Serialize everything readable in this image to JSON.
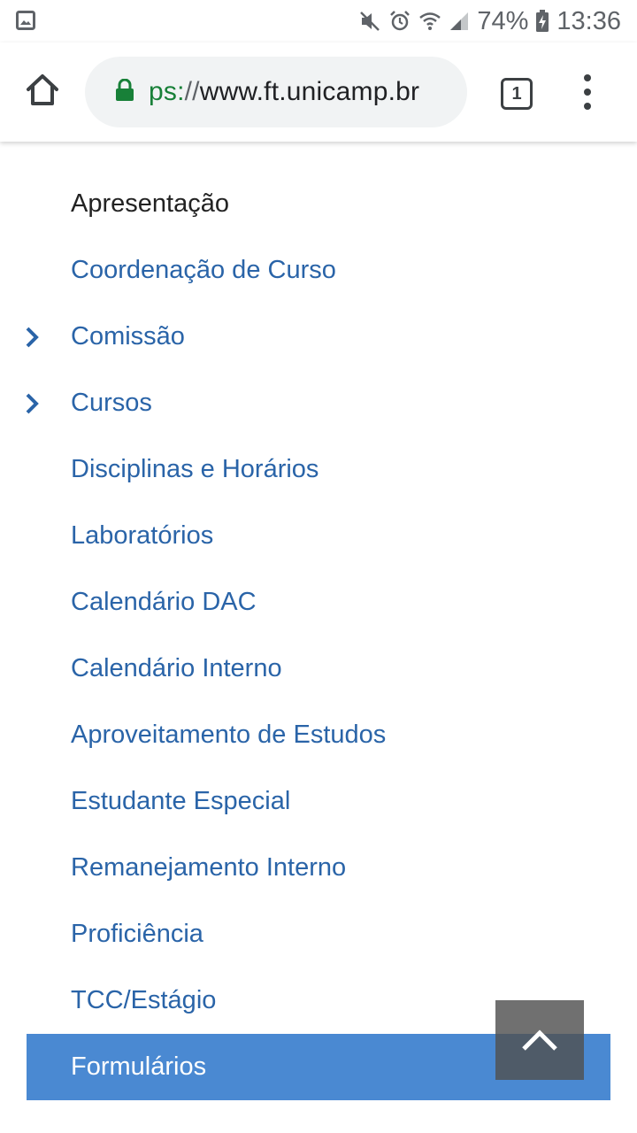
{
  "status_bar": {
    "battery": "74%",
    "time": "13:36",
    "icons": [
      "gallery-icon",
      "mute-icon",
      "alarm-icon",
      "wifi-icon",
      "signal-icon",
      "battery-charging-icon"
    ]
  },
  "browser": {
    "url_scheme": "ps:",
    "url_sep": "//",
    "url_host": "www.ft.unicamp.br",
    "tab_count": "1",
    "icons": [
      "home-icon",
      "lock-icon",
      "tabs-icon",
      "more-vert-icon"
    ]
  },
  "menu": {
    "items": [
      {
        "label": "Apresentação",
        "state": "current"
      },
      {
        "label": "Coordenação de Curso"
      },
      {
        "label": "Comissão",
        "expandable": true
      },
      {
        "label": "Cursos",
        "expandable": true
      },
      {
        "label": "Disciplinas e Horários"
      },
      {
        "label": "Laboratórios"
      },
      {
        "label": "Calendário DAC"
      },
      {
        "label": "Calendário Interno"
      },
      {
        "label": "Aproveitamento de Estudos"
      },
      {
        "label": "Estudante Especial"
      },
      {
        "label": "Remanejamento Interno"
      },
      {
        "label": "Proficiência"
      },
      {
        "label": "TCC/Estágio"
      },
      {
        "label": "Formulários",
        "state": "active"
      }
    ]
  },
  "colors": {
    "link": "#2a64a8",
    "active_bg": "#4a89d2",
    "secure": "#188038"
  }
}
